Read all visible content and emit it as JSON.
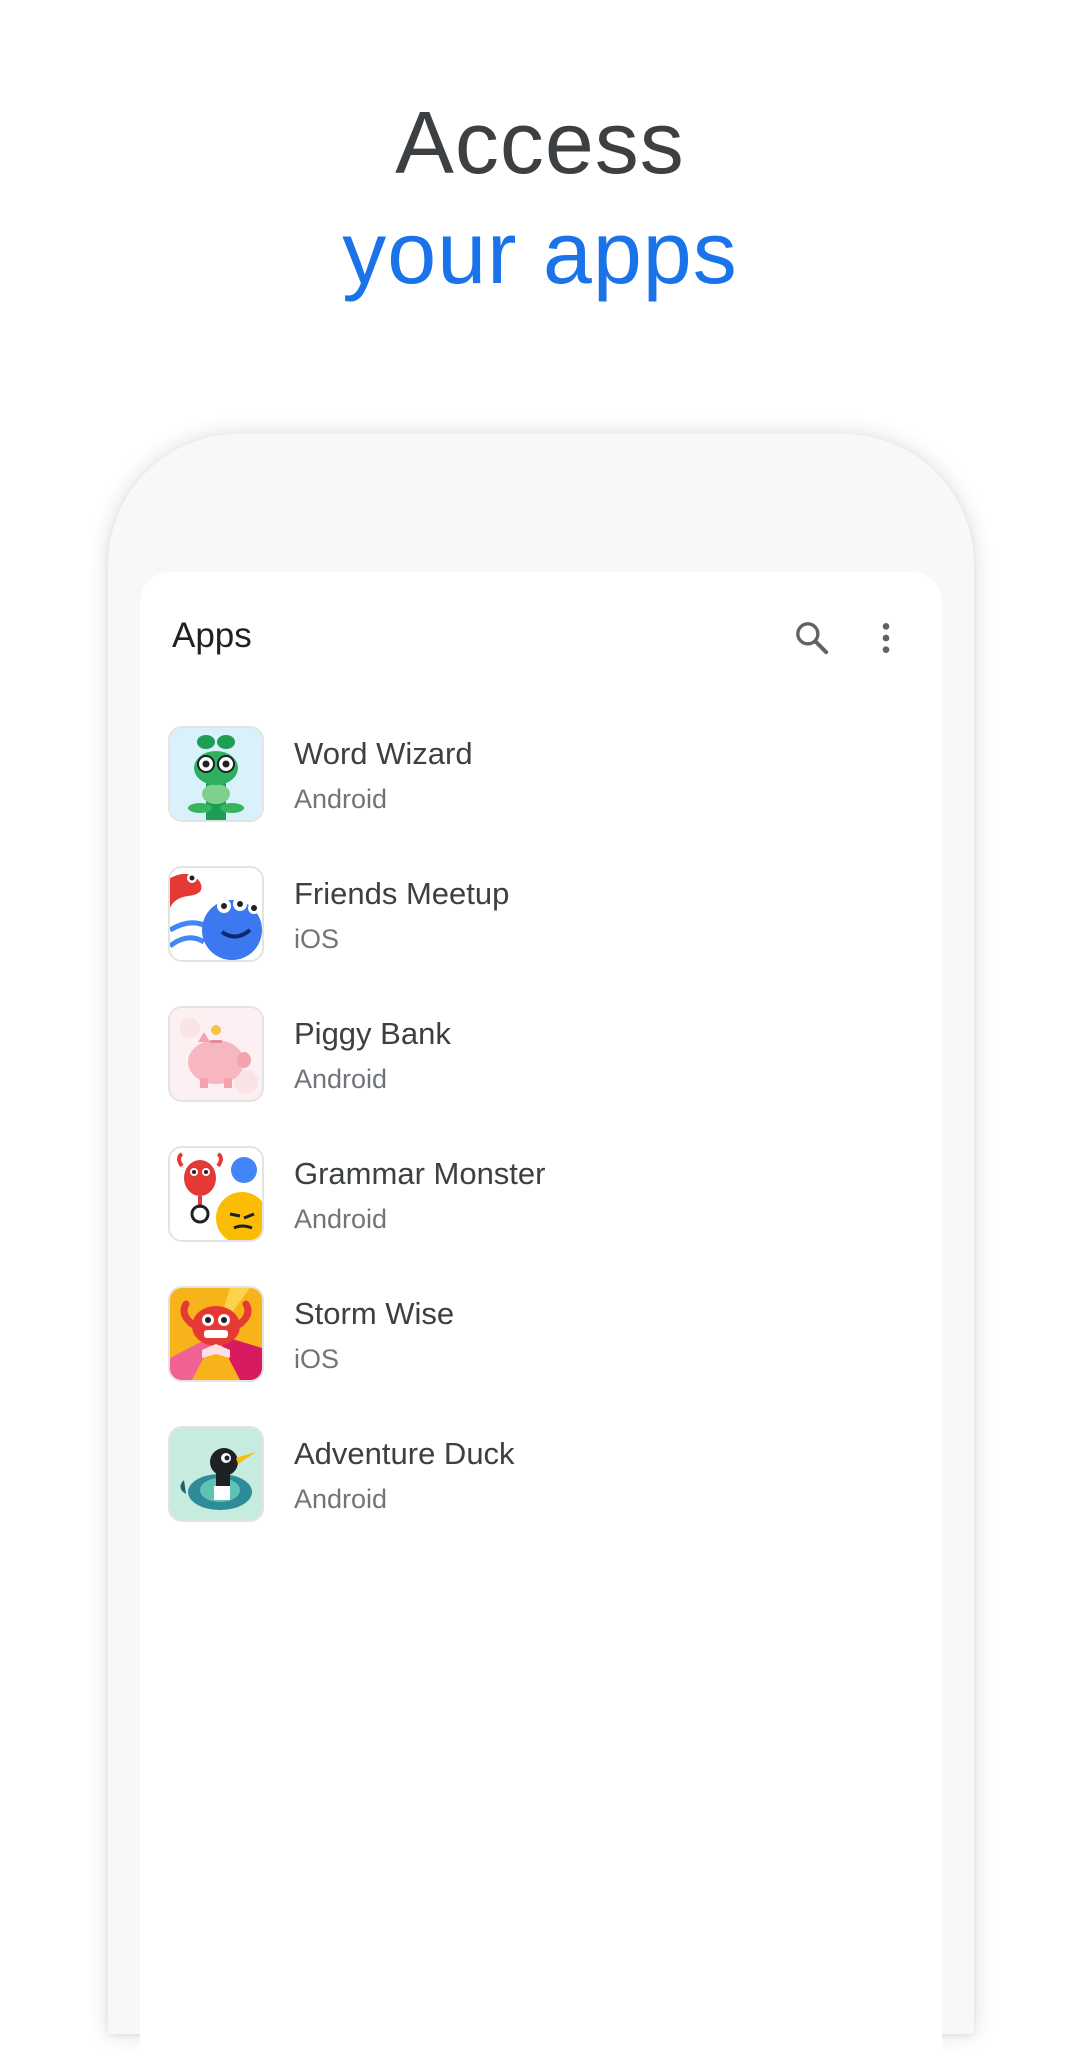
{
  "headline": {
    "line1": "Access",
    "line2": "your apps"
  },
  "app_bar": {
    "title": "Apps",
    "search_icon": "search-icon",
    "more_icon": "more-vert-icon"
  },
  "apps": [
    {
      "name": "Word Wizard",
      "platform": "Android",
      "icon": "word-wizard-icon"
    },
    {
      "name": "Friends Meetup",
      "platform": "iOS",
      "icon": "friends-meetup-icon"
    },
    {
      "name": "Piggy Bank",
      "platform": "Android",
      "icon": "piggy-bank-icon"
    },
    {
      "name": "Grammar Monster",
      "platform": "Android",
      "icon": "grammar-monster-icon"
    },
    {
      "name": "Storm Wise",
      "platform": "iOS",
      "icon": "storm-wise-icon"
    },
    {
      "name": "Adventure Duck",
      "platform": "Android",
      "icon": "adventure-duck-icon"
    }
  ],
  "colors": {
    "headline_dark": "#3c4043",
    "headline_accent": "#1a73e8",
    "phone_frame": "#f8f8f8",
    "secondary_text": "#70757a"
  }
}
